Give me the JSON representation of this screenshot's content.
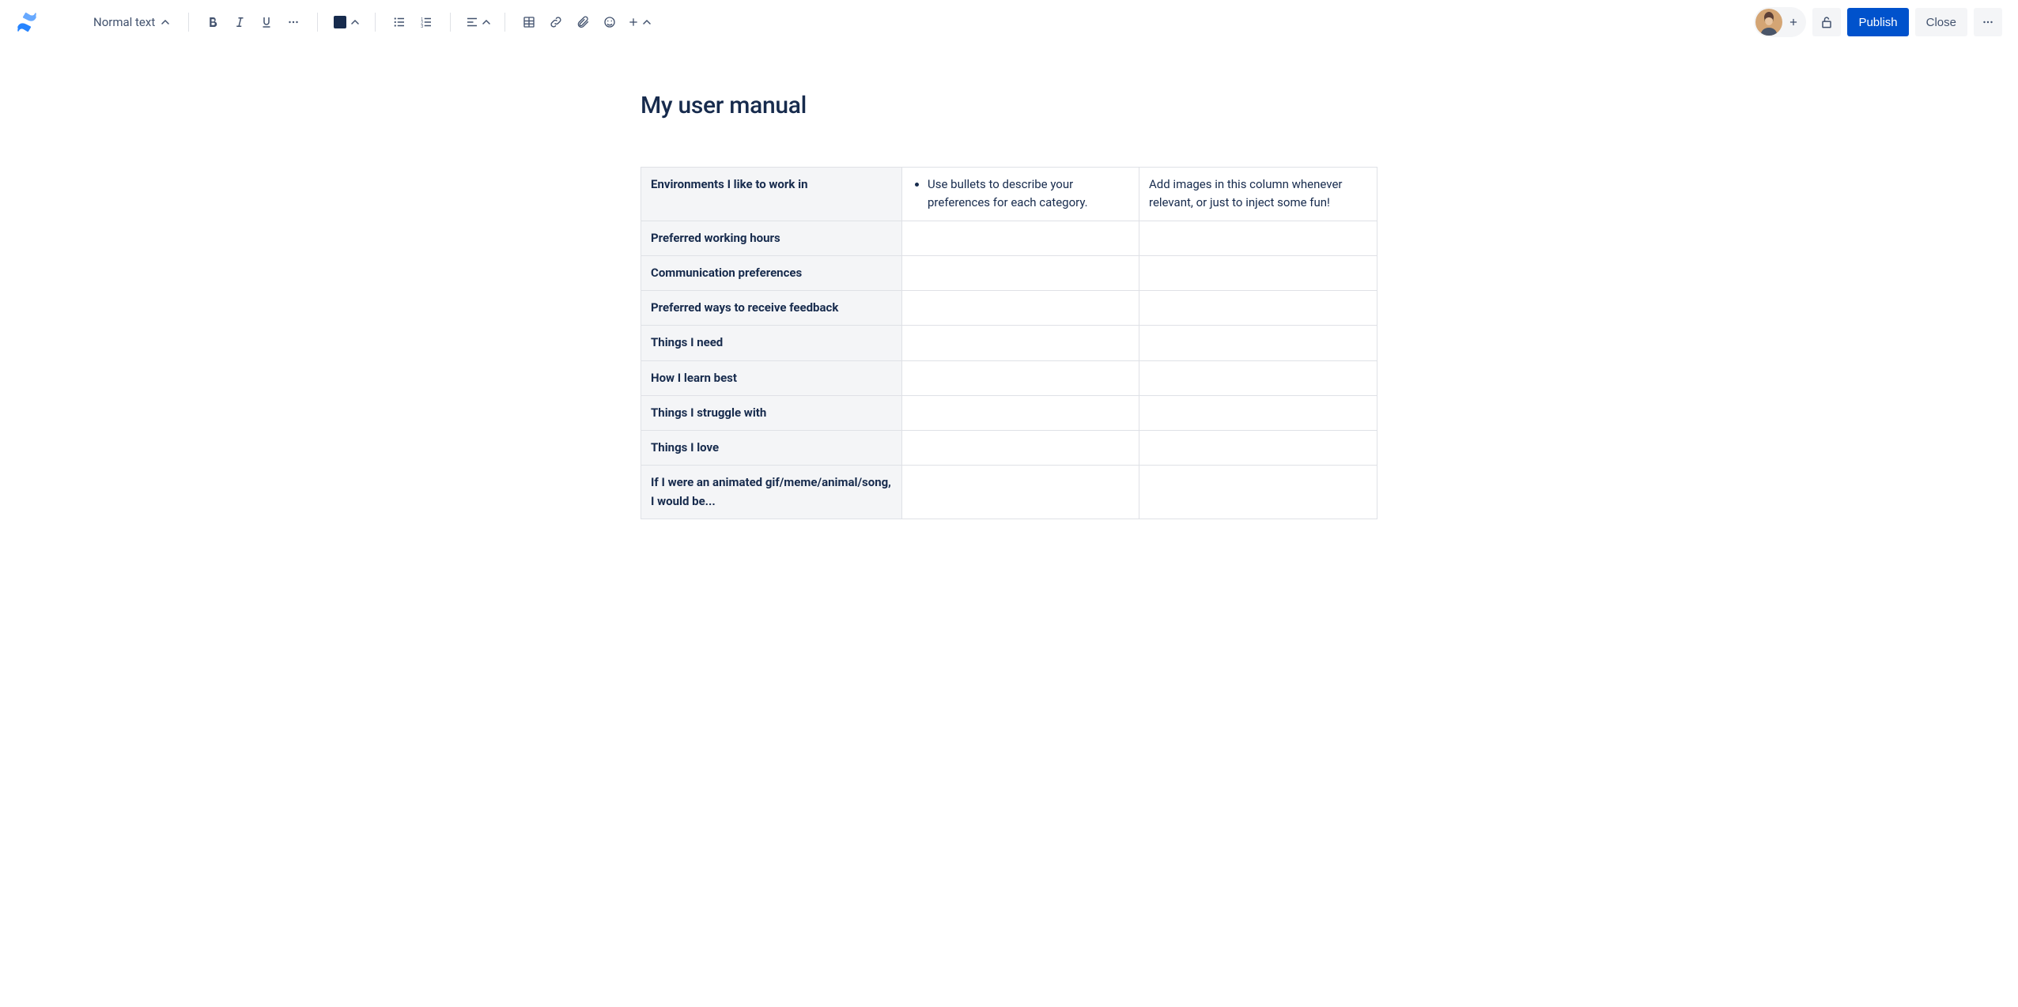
{
  "toolbar": {
    "text_style_label": "Normal text",
    "publish_label": "Publish",
    "close_label": "Close"
  },
  "page": {
    "title": "My user manual"
  },
  "table": {
    "rows": [
      {
        "label": "Environments I like to work in",
        "bullets": [
          "Use bullets to describe your preferences for each category."
        ],
        "note": "Add images in this column whenever relevant, or just to inject some fun!"
      },
      {
        "label": "Preferred working hours",
        "bullets": [],
        "note": ""
      },
      {
        "label": "Communication preferences",
        "bullets": [],
        "note": ""
      },
      {
        "label": "Preferred ways to receive feedback",
        "bullets": [],
        "note": ""
      },
      {
        "label": "Things I need",
        "bullets": [],
        "note": ""
      },
      {
        "label": "How I learn best",
        "bullets": [],
        "note": ""
      },
      {
        "label": "Things I struggle with",
        "bullets": [],
        "note": ""
      },
      {
        "label": "Things I love",
        "bullets": [],
        "note": ""
      },
      {
        "label": "If I were an animated gif/meme/animal/song, I would be...",
        "bullets": [],
        "note": ""
      }
    ]
  }
}
